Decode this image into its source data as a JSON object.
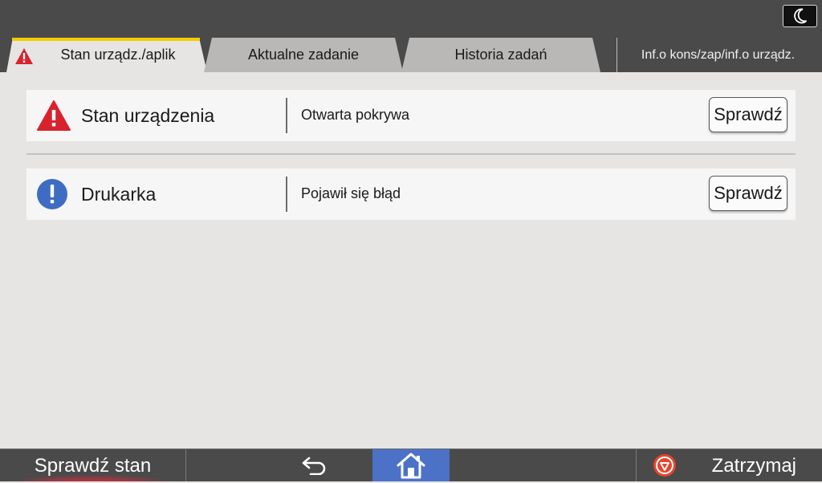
{
  "tabs": [
    {
      "label": "Stan urządz./aplik",
      "active": true
    },
    {
      "label": "Aktualne zadanie",
      "active": false
    },
    {
      "label": "Historia zadań",
      "active": false
    },
    {
      "label": "Inf.o kons/zap/inf.o urządz.",
      "active": false
    }
  ],
  "rows": [
    {
      "name": "Stan urządzenia",
      "status": "Otwarta pokrywa",
      "button": "Sprawdź",
      "icon": "warning-triangle-icon"
    },
    {
      "name": "Drukarka",
      "status": "Pojawił się błąd",
      "button": "Sprawdź",
      "icon": "exclamation-circle-icon"
    }
  ],
  "bottom": {
    "check_status": "Sprawdź stan",
    "stop": "Zatrzymaj"
  },
  "colors": {
    "warning": "#d8232e",
    "info": "#3f6cc3",
    "active_tab_indicator": "#f5cc00",
    "home": "#4c72c7",
    "bar": "#4a4a4a"
  }
}
